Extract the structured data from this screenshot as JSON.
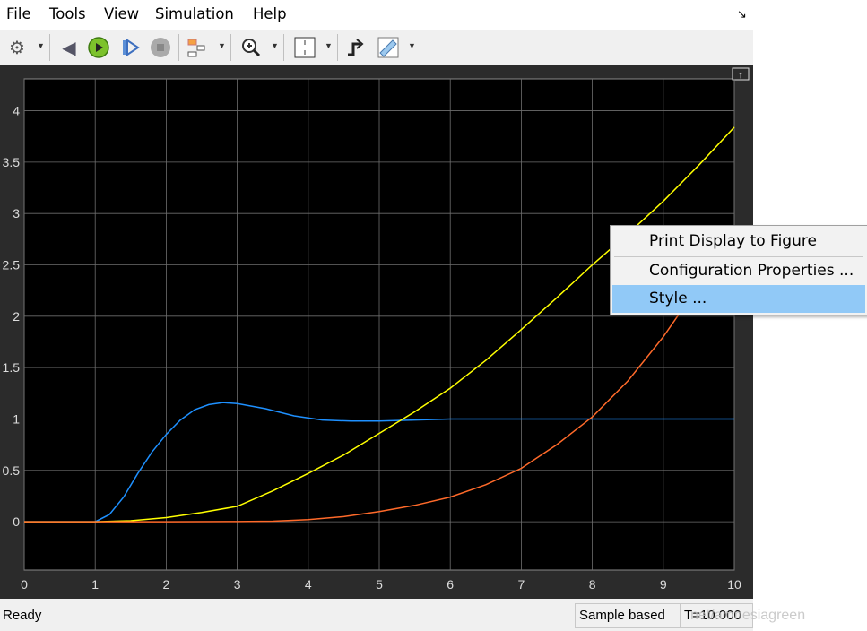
{
  "menubar": {
    "items": [
      "File",
      "Tools",
      "View",
      "Simulation",
      "Help"
    ]
  },
  "toolbar": {
    "icons": [
      "gear-icon",
      "step-back-icon",
      "run-icon",
      "step-forward-icon",
      "stop-icon",
      "signal-selector-icon",
      "zoom-in-icon",
      "scale-axes-icon",
      "triggers-icon",
      "measurements-icon"
    ]
  },
  "context_menu": {
    "items": [
      "Print Display to Figure",
      "Configuration Properties ...",
      "Style ..."
    ],
    "highlighted": "Style ..."
  },
  "status": {
    "ready": "Ready",
    "mode": "Sample based",
    "time": "T=10.000"
  },
  "watermark": "net/amnesiagreen",
  "colors": {
    "background": "#000000",
    "grid": "#6e6e6e",
    "blue": "#1e90ff",
    "yellow": "#ffff00",
    "orange": "#ff6a2a",
    "menu_highlight": "#91c9f7"
  },
  "chart_data": {
    "type": "line",
    "xlim": [
      0,
      10
    ],
    "ylim": [
      -0.47,
      4.31
    ],
    "grid": true,
    "xticks": [
      "0",
      "1",
      "2",
      "3",
      "4",
      "5",
      "6",
      "7",
      "8",
      "9",
      "10"
    ],
    "yticks": [
      "0",
      "0.5",
      "1",
      "1.5",
      "2",
      "2.5",
      "3",
      "3.5",
      "4"
    ],
    "series": [
      {
        "color": "#1e90ff",
        "x": [
          0,
          1,
          1.2,
          1.4,
          1.6,
          1.8,
          2,
          2.2,
          2.4,
          2.6,
          2.8,
          3,
          3.4,
          3.8,
          4.2,
          4.6,
          5,
          5.5,
          6,
          7,
          8,
          9,
          10
        ],
        "y": [
          0,
          0,
          0.07,
          0.24,
          0.47,
          0.68,
          0.85,
          0.99,
          1.09,
          1.14,
          1.16,
          1.15,
          1.1,
          1.03,
          0.99,
          0.98,
          0.98,
          0.99,
          1.0,
          1.0,
          1.0,
          1.0,
          1.0
        ]
      },
      {
        "color": "#ffff00",
        "x": [
          0,
          1,
          1.5,
          2,
          2.5,
          3,
          3.5,
          4,
          4.5,
          5,
          5.5,
          6,
          6.5,
          7,
          7.5,
          8,
          8.5,
          9,
          9.5,
          10
        ],
        "y": [
          0,
          0,
          0.01,
          0.04,
          0.09,
          0.15,
          0.3,
          0.47,
          0.65,
          0.86,
          1.07,
          1.3,
          1.57,
          1.87,
          2.18,
          2.5,
          2.8,
          3.12,
          3.47,
          3.84
        ]
      },
      {
        "color": "#ff6a2a",
        "x": [
          0,
          1,
          2,
          3,
          3.5,
          4,
          4.5,
          5,
          5.5,
          6,
          6.5,
          7,
          7.5,
          8,
          8.5,
          9,
          9.5,
          10
        ],
        "y": [
          0,
          0,
          0,
          0.002,
          0.005,
          0.02,
          0.05,
          0.1,
          0.16,
          0.24,
          0.36,
          0.52,
          0.75,
          1.02,
          1.37,
          1.8,
          2.3,
          2.82
        ]
      }
    ]
  }
}
